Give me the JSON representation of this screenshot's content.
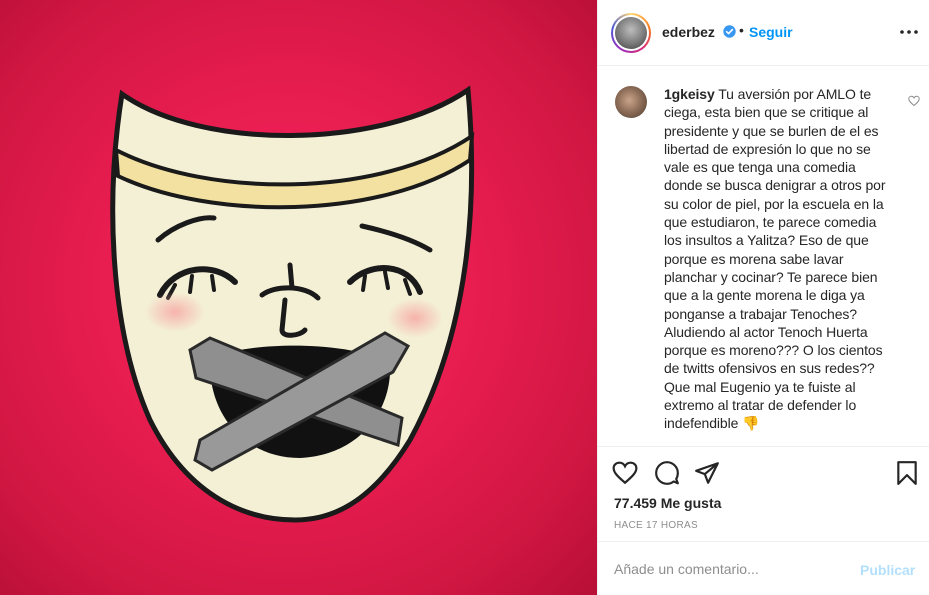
{
  "post": {
    "media": {
      "description_icon": "theater-mask-taped-icon",
      "background_color": "#e81d50"
    },
    "header": {
      "username": "ederbez",
      "verified_icon": "verified-badge-icon",
      "separator": "•",
      "follow_label": "Seguir",
      "more_icon": "more-options-icon"
    },
    "comment": {
      "username": "1gkeisy",
      "text": "Tu aversión por AMLO te ciega, esta bien que se critique al presidente y que se burlen de el es libertad de expresión lo que no se vale es que tenga una comedia donde se busca denigrar a otros por su color de piel, por la escuela en la que estudiaron, te parece comedia los insultos a Yalitza? Eso de que porque es morena sabe lavar planchar y cocinar? Te parece bien que a la gente morena le diga ya ponganse a trabajar Tenoches? Aludiendo al actor Tenoch Huerta porque es moreno??? O los cientos de twitts ofensivos en sus redes?? Que mal Eugenio ya te fuiste al extremo al tratar de defender lo indefendible",
      "emoji": "👎",
      "like_icon": "heart-outline-icon"
    },
    "actions": {
      "like_icon": "heart-icon",
      "comment_icon": "comment-bubble-icon",
      "share_icon": "paper-plane-icon",
      "save_icon": "bookmark-icon"
    },
    "likes_text": "77.459 Me gusta",
    "timestamp": "HACE 17 HORAS",
    "add_comment": {
      "placeholder": "Añade un comentario...",
      "publish_label": "Publicar",
      "accent_color": "#0095f6"
    }
  }
}
